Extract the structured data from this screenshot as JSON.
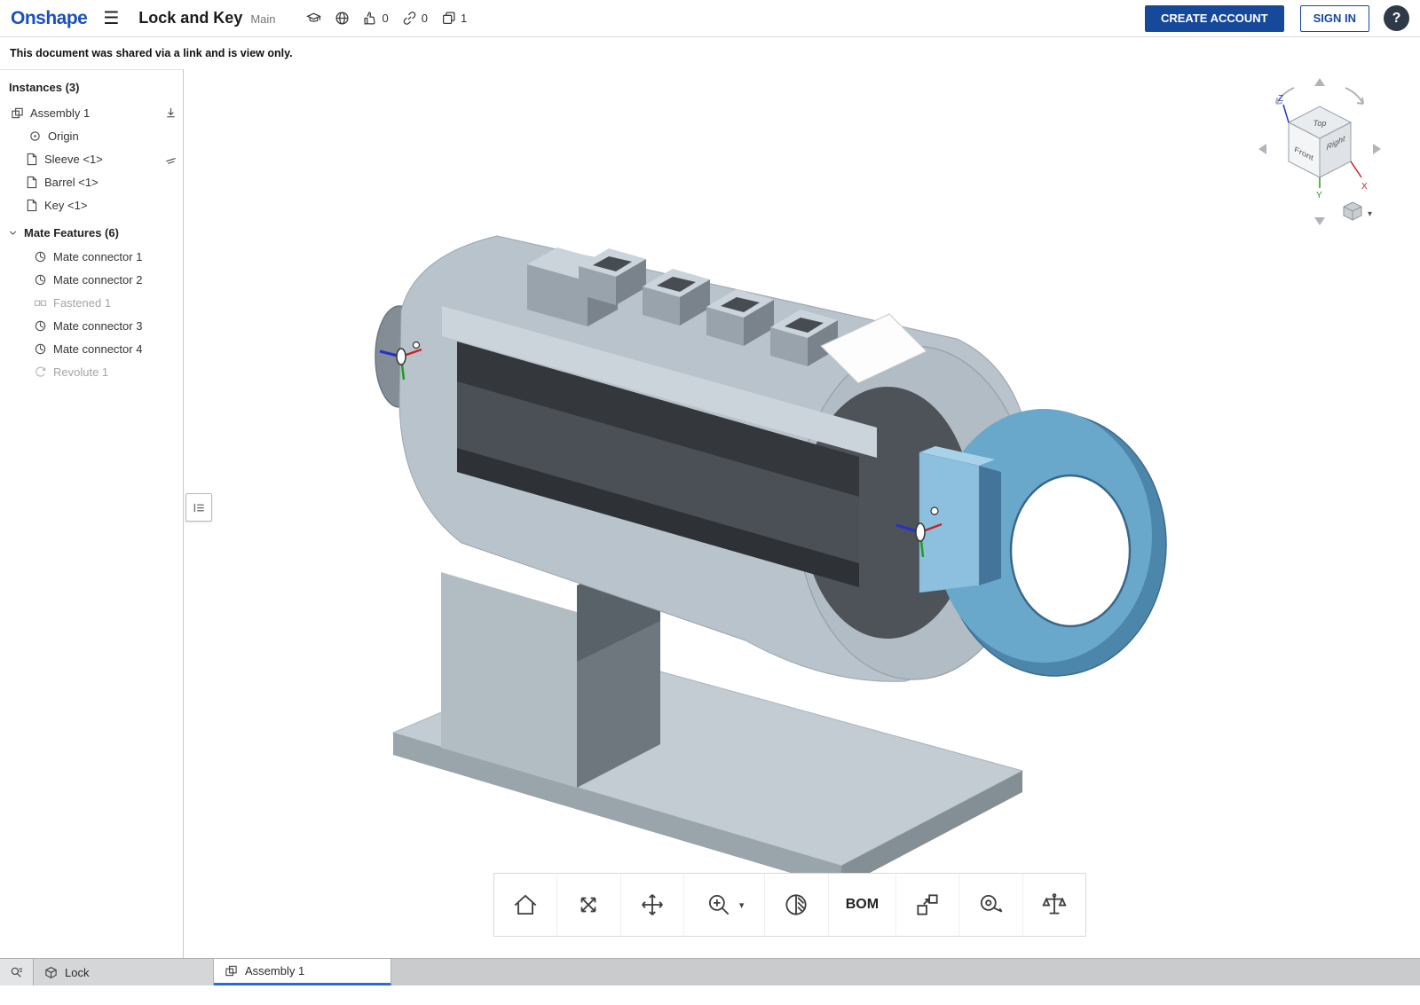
{
  "icons": {
    "hamburger": "☰",
    "help": "?",
    "chevron_down": "▾"
  },
  "header": {
    "logo": "Onshape",
    "title": "Lock and Key",
    "workspace": "Main",
    "likes_count": "0",
    "links_count": "0",
    "copies_count": "1",
    "create_account_label": "CREATE ACCOUNT",
    "sign_in_label": "SIGN IN"
  },
  "notice": "This document was shared via a link and is view only.",
  "panel": {
    "instances_header": "Instances (3)",
    "instances": [
      {
        "label": "Assembly 1"
      },
      {
        "label": "Origin"
      },
      {
        "label": "Sleeve <1>"
      },
      {
        "label": "Barrel <1>"
      },
      {
        "label": "Key <1>"
      }
    ],
    "mates_header": "Mate Features (6)",
    "mates": [
      {
        "label": "Mate connector 1"
      },
      {
        "label": "Mate connector 2"
      },
      {
        "label": "Fastened 1"
      },
      {
        "label": "Mate connector 3"
      },
      {
        "label": "Mate connector 4"
      },
      {
        "label": "Revolute 1"
      }
    ]
  },
  "viewcube": {
    "top": "Top",
    "front": "Front",
    "right": "Right",
    "axis_x": "X",
    "axis_y": "Y",
    "axis_z": "Z"
  },
  "toolbar": {
    "bom_label": "BOM"
  },
  "tabs": [
    {
      "label": "Lock"
    },
    {
      "label": "Assembly 1"
    }
  ],
  "colors": {
    "brand_blue": "#1a50c0",
    "button_blue": "#17499b",
    "tab_accent": "#2a6bd6",
    "key_blue": "#5e9dc3",
    "axis_x_red": "#cc2222",
    "axis_y_green": "#1f9d1f",
    "axis_z_blue": "#2233cc"
  }
}
